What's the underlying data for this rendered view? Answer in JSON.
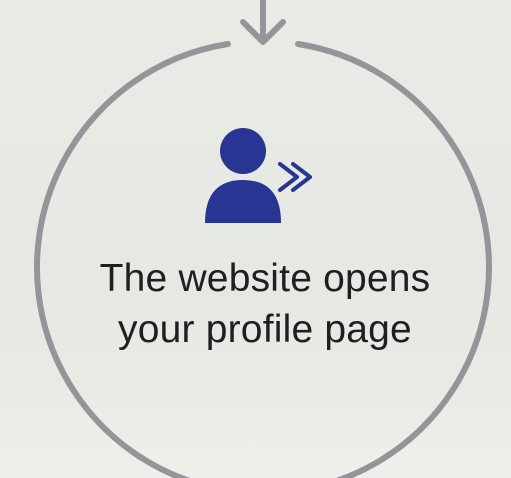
{
  "step": {
    "icon": "user-redirect-icon",
    "text_line_1": "The website opens",
    "text_line_2": "your profile page"
  },
  "colors": {
    "ring": "#939598",
    "icon": "#283593",
    "text": "#1f1f1f",
    "background": "#e8eae5"
  }
}
